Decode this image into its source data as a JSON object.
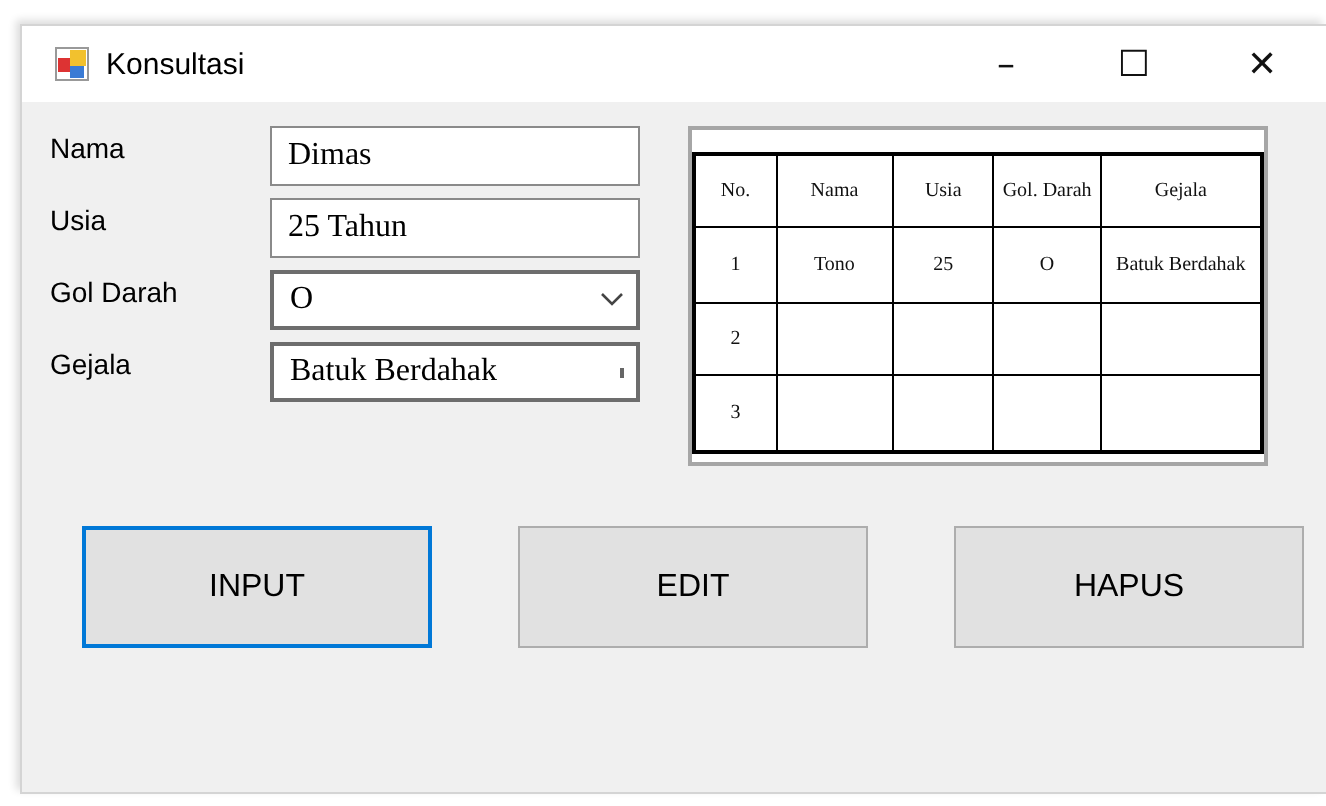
{
  "window": {
    "title": "Konsultasi",
    "controls": [
      "–",
      "☐",
      "✕"
    ]
  },
  "form": [
    {
      "label": "Nama",
      "kind": "text",
      "value": "Dimas"
    },
    {
      "label": "Usia",
      "kind": "text",
      "value": "25 Tahun"
    },
    {
      "label": "Gol Darah",
      "kind": "dropdown",
      "value": "O"
    },
    {
      "label": "Gejala",
      "kind": "listbox",
      "value": "Batuk Berdahak"
    }
  ],
  "table": {
    "columns": [
      "No.",
      "Nama",
      "Usia",
      "Gol. Darah",
      "Gejala"
    ],
    "rows": [
      [
        "1",
        "Tono",
        "25",
        "O",
        "Batuk Berdahak"
      ],
      [
        "2",
        "",
        "",
        "",
        ""
      ],
      [
        "3",
        "",
        "",
        "",
        ""
      ]
    ]
  },
  "buttons": [
    {
      "label": "INPUT",
      "focused": true
    },
    {
      "label": "EDIT",
      "focused": false
    },
    {
      "label": "HAPUS",
      "focused": false
    }
  ]
}
